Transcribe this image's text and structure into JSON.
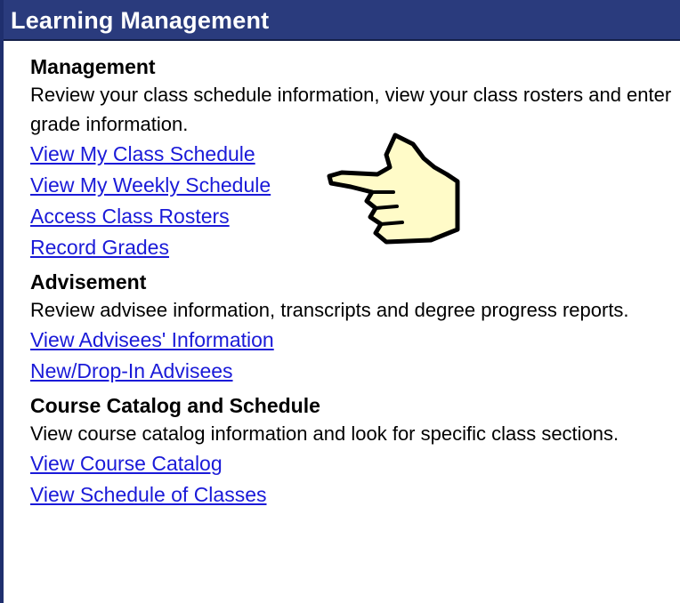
{
  "header": {
    "title": "Learning Management"
  },
  "sections": [
    {
      "title": "Management",
      "description": "Review your class schedule information, view your class rosters and enter grade information.",
      "links": [
        "View My Class Schedule",
        "View My Weekly Schedule",
        "Access Class Rosters",
        "Record Grades"
      ]
    },
    {
      "title": "Advisement",
      "description": "Review advisee information, transcripts and degree progress reports.",
      "links": [
        "View Advisees' Information",
        "New/Drop-In Advisees"
      ]
    },
    {
      "title": "Course Catalog and Schedule",
      "description": "View course catalog information and look for specific class sections.",
      "links": [
        "View Course Catalog",
        "View Schedule of Classes"
      ]
    }
  ],
  "cursor": {
    "icon": "pointing-hand-cursor-icon",
    "color": "#fffbc8"
  },
  "colors": {
    "header_bg": "#2a3b7d",
    "link": "#1a1ad8"
  }
}
